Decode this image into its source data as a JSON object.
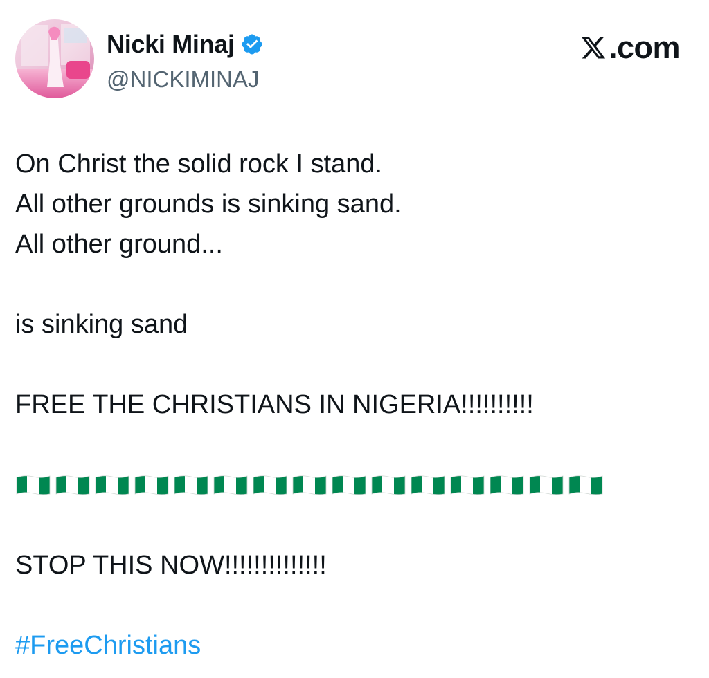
{
  "author": {
    "display_name": "Nicki Minaj",
    "handle": "@NICKIMINAJ",
    "verified": true,
    "avatar_icon": "profile-photo"
  },
  "brand": {
    "label": "X.com",
    "icon": "x-logo-icon"
  },
  "tweet": {
    "lines": [
      "On Christ the solid rock I stand.",
      "All other grounds is sinking sand.",
      "All other ground...",
      "is sinking sand",
      "FREE THE CHRISTIANS IN NIGERIA!!!!!!!!!!",
      "STOP THIS NOW!!!!!!!!!!!!!!"
    ],
    "flag_count": 15,
    "flag_icon": "nigeria-flag-icon",
    "hashtag": "#FreeChristians"
  },
  "colors": {
    "text": "#0f1419",
    "secondary": "#536471",
    "accent": "#1d9bf0",
    "flag_green": "#008751"
  }
}
